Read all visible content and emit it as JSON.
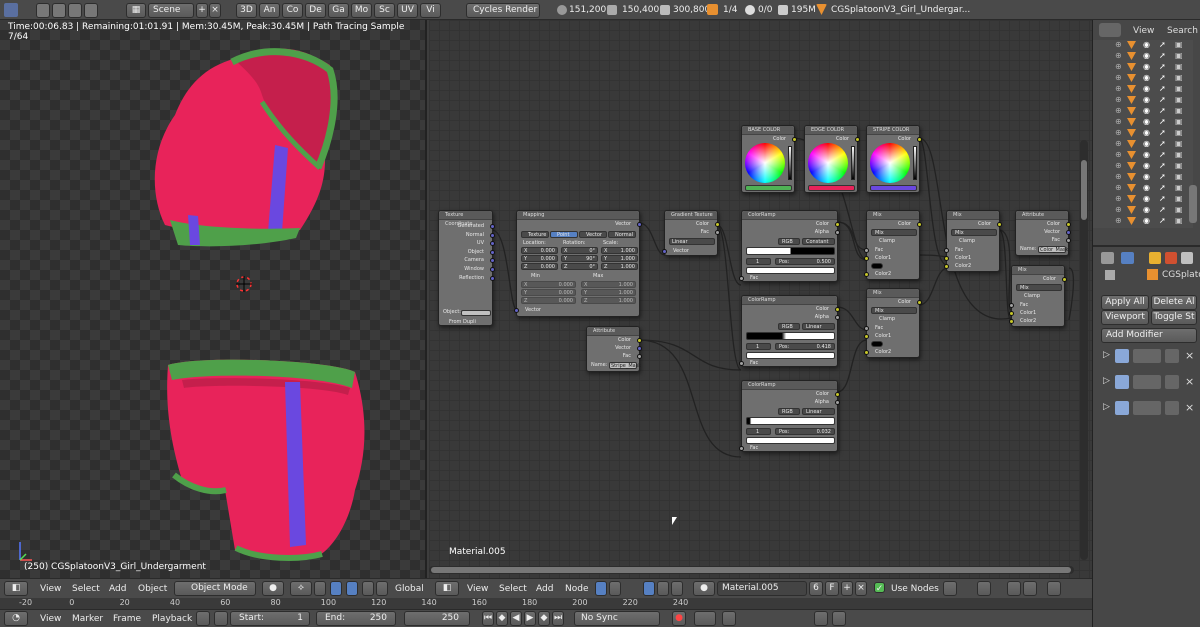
{
  "topbar": {
    "scene": "Scene",
    "tabs": [
      "3D",
      "An",
      "Co",
      "De",
      "Ga",
      "Mo",
      "Sc",
      "UV",
      "Vi"
    ],
    "engine": "Cycles Render",
    "stats": {
      "verts": "151,200",
      "faces": "150,400",
      "tris": "300,800",
      "objects": "1/4",
      "lamps": "0/0",
      "mem": "195M"
    },
    "file": "CGSplatoonV3_Girl_Undergar..."
  },
  "viewport": {
    "status": "Time:00:06.83 | Remaining:01:01.91 | Mem:30.45M, Peak:30.45M | Path Tracing Sample 7/64",
    "object_label": "(250) CGSplatoonV3_Girl_Undergarment",
    "header": {
      "view": "View",
      "select": "Select",
      "add": "Add",
      "object": "Object",
      "mode": "Object Mode",
      "orientation": "Global"
    }
  },
  "node_editor": {
    "material_label": "Material.005",
    "header": {
      "view": "View",
      "select": "Select",
      "add": "Add",
      "node": "Node",
      "material": "Material.005",
      "users": "6",
      "fake": "F",
      "use_nodes": "Use Nodes"
    },
    "nodes": {
      "texcoord": {
        "title": "Texture Coordinate",
        "outputs": [
          "Generated",
          "Normal",
          "UV",
          "Object",
          "Camera",
          "Window",
          "Reflection"
        ],
        "object_label": "Object:",
        "from_dupli": "From Dupli"
      },
      "mapping": {
        "title": "Mapping",
        "output": "Vector",
        "modes": [
          "Texture",
          "Point",
          "Vector",
          "Normal"
        ],
        "cols": [
          "Location:",
          "Rotation:",
          "Scale:"
        ],
        "rows": [
          [
            "X",
            "0.000",
            "X",
            "0°",
            "X",
            "1.000"
          ],
          [
            "Y",
            "0.000",
            "Y",
            "90°",
            "Y",
            "1.000"
          ],
          [
            "Z",
            "0.000",
            "Z",
            "0°",
            "Z",
            "1.000"
          ]
        ],
        "min": "Min",
        "max": "Max",
        "min_rows": [
          [
            "X",
            "0.000",
            "X",
            "1.000"
          ],
          [
            "Y",
            "0.000",
            "Y",
            "1.000"
          ],
          [
            "Z",
            "0.000",
            "Z",
            "1.000"
          ]
        ],
        "input": "Vector"
      },
      "gradient": {
        "title": "Gradient Texture",
        "outputs": [
          "Color",
          "Fac"
        ],
        "type": "Linear",
        "input": "Vector"
      },
      "base": {
        "title": "BASE COLOR",
        "output": "Color"
      },
      "edge": {
        "title": "EDGE COLOR",
        "output": "Color"
      },
      "stripe": {
        "title": "STRIPE COLOR",
        "output": "Color"
      },
      "ramp1": {
        "title": "ColorRamp",
        "outputs": [
          "Color",
          "Alpha"
        ],
        "mode": "RGB",
        "interp": "Constant",
        "index": "1",
        "pos_label": "Pos:",
        "pos": "0.500",
        "input": "Fac"
      },
      "ramp2": {
        "title": "ColorRamp",
        "outputs": [
          "Color",
          "Alpha"
        ],
        "mode": "RGB",
        "interp": "Linear",
        "index": "1",
        "pos_label": "Pos:",
        "pos": "0.418",
        "input": "Fac"
      },
      "ramp3": {
        "title": "ColorRamp",
        "outputs": [
          "Color",
          "Alpha"
        ],
        "mode": "RGB",
        "interp": "Linear",
        "index": "1",
        "pos_label": "Pos:",
        "pos": "0.032",
        "input": "Fac"
      },
      "attribute": {
        "title": "Attribute",
        "outputs": [
          "Color",
          "Vector",
          "Fac"
        ],
        "name_label": "Name:",
        "name": "Stripe_Mask"
      },
      "attribute2": {
        "title": "Attribute",
        "outputs": [
          "Color",
          "Vector",
          "Fac"
        ],
        "name_label": "Name:",
        "name": "Color_Mask"
      },
      "mix1": {
        "title": "Mix",
        "output": "Color",
        "mode": "Mix",
        "clamp": "Clamp",
        "inputs": [
          "Fac",
          "Color1",
          "Color2"
        ]
      },
      "mix2": {
        "title": "Mix",
        "output": "Color",
        "mode": "Mix",
        "clamp": "Clamp",
        "inputs": [
          "Fac",
          "Color1",
          "Color2"
        ]
      },
      "mix3": {
        "title": "Mix",
        "output": "Color",
        "mode": "Mix",
        "clamp": "Clamp",
        "inputs": [
          "Fac",
          "Color1",
          "Color2"
        ]
      },
      "mix4": {
        "title": "Mix",
        "output": "Color",
        "mode": "Mix",
        "clamp": "Clamp",
        "inputs": [
          "Fac",
          "Color1",
          "Color2"
        ]
      }
    }
  },
  "outliner": {
    "view": "View",
    "search": "Search"
  },
  "properties": {
    "object_name": "CGSplato",
    "apply_all": "Apply All",
    "delete_all": "Delete Al",
    "viewport": "Viewport",
    "toggle": "Toggle St",
    "add_modifier": "Add Modifier"
  },
  "timeline": {
    "ruler": [
      "-20",
      "0",
      "20",
      "40",
      "60",
      "80",
      "100",
      "120",
      "140",
      "160",
      "180",
      "200",
      "220",
      "240"
    ],
    "menu": [
      "View",
      "Marker",
      "Frame",
      "Playback"
    ],
    "start_label": "Start:",
    "start": "1",
    "end_label": "End:",
    "end": "250",
    "current": "250",
    "sync": "No Sync"
  }
}
